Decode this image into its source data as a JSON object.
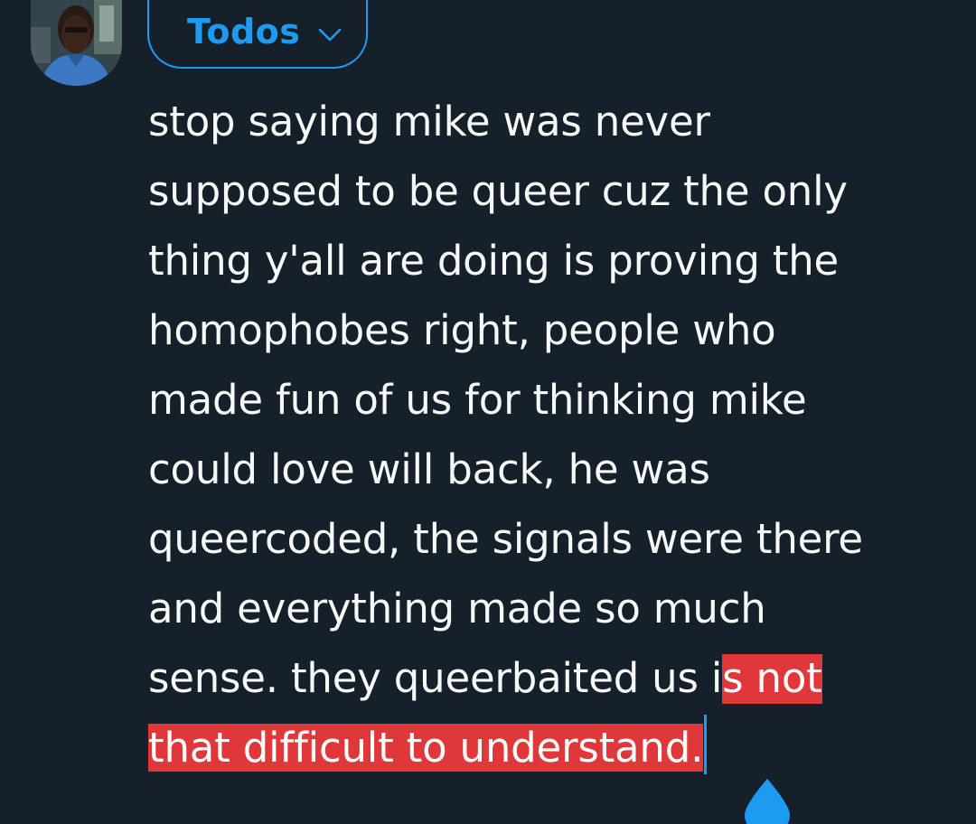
{
  "composer": {
    "audience_label": "Todos",
    "text_lines": [
      "stop saying mike was never",
      "supposed to be queer cuz the only",
      "thing y'all are doing is proving the",
      "homophobes right, people who",
      "made fun of us for thinking mike",
      "could love will back, he was",
      "queercoded, the signals were there",
      "and everything made so much"
    ],
    "line9_before_selection": "sense. they queerbaited us i",
    "line9_selected": "s not",
    "line10_selected": "that difficult to understand."
  },
  "colors": {
    "background": "#15202b",
    "text": "#f7f9f9",
    "accent": "#1d9bf0",
    "selection": "#e0383a"
  },
  "icons": {
    "audience_chevron": "chevron-down-icon",
    "selection_handle": "selection-handle-icon"
  }
}
